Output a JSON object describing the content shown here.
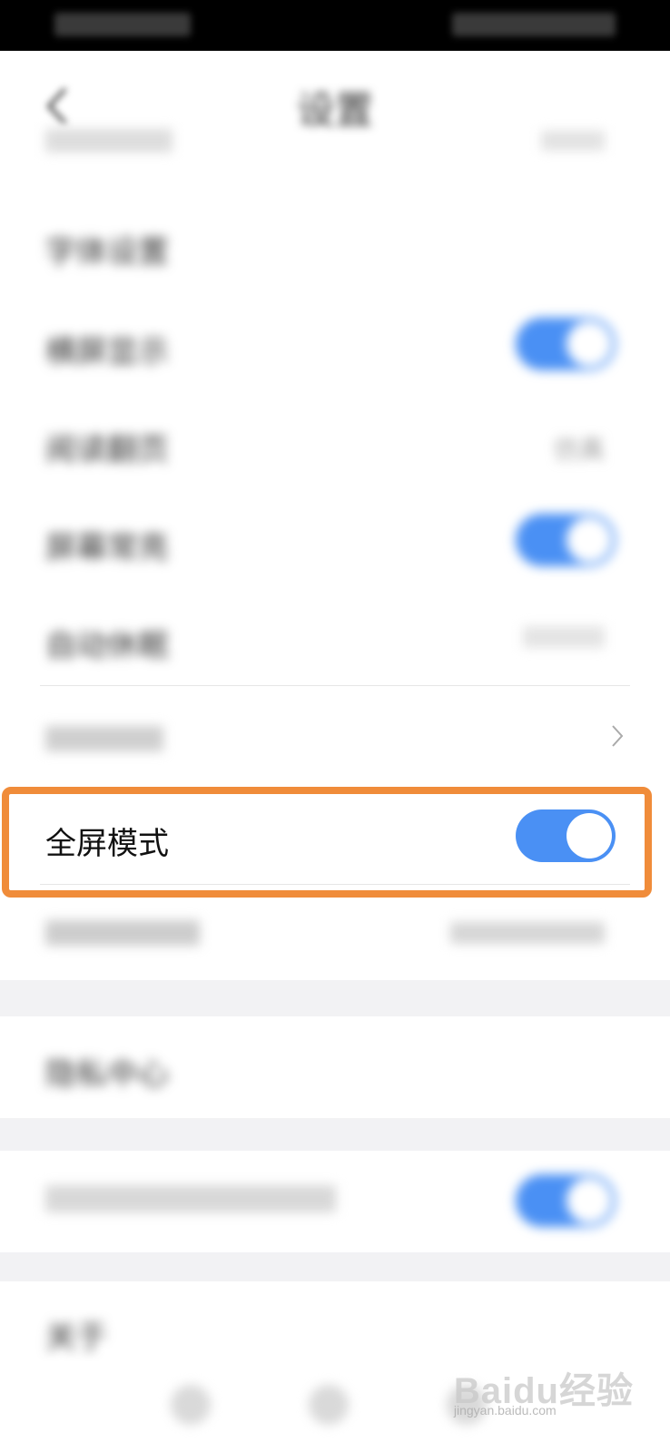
{
  "status_bar": {
    "left": "",
    "right": ""
  },
  "header": {
    "title": "设置"
  },
  "settings": [
    {
      "label": "",
      "value": ""
    },
    {
      "label": "字体设置",
      "value": ""
    },
    {
      "label": "横屏显示",
      "toggle": true
    },
    {
      "label": "阅读翻页",
      "value": "仿真"
    },
    {
      "label": "屏幕常亮",
      "toggle": true
    },
    {
      "label": "自动休眠",
      "value": ""
    },
    {
      "label": "",
      "chevron": true
    },
    {
      "label": "全屏模式",
      "toggle": true,
      "highlighted": true
    },
    {
      "label": "",
      "value": ""
    }
  ],
  "section2": {
    "label": "隐私中心"
  },
  "section3": {
    "label": "",
    "toggle": true
  },
  "section4": {
    "label": "关于"
  },
  "watermark": {
    "brand": "Baidu经验",
    "url": "jingyan.baidu.com"
  },
  "colors": {
    "accent": "#4a90f4",
    "highlight": "#f08c3a"
  },
  "icons": {
    "back": "chevron-left-icon",
    "forward": "chevron-right-icon"
  }
}
